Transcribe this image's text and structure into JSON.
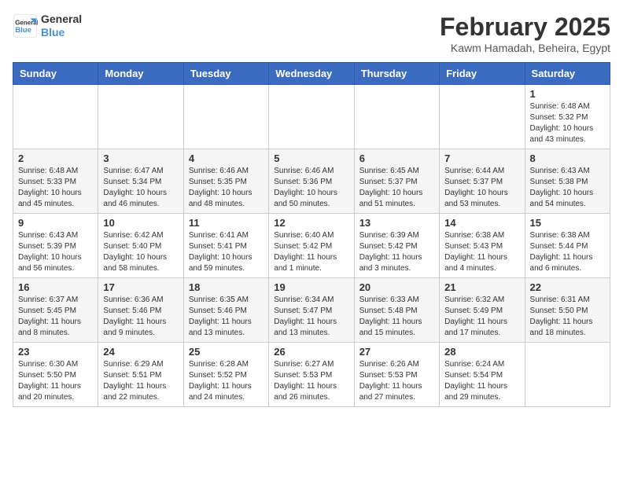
{
  "header": {
    "logo_line1": "General",
    "logo_line2": "Blue",
    "title": "February 2025",
    "subtitle": "Kawm Hamadah, Beheira, Egypt"
  },
  "calendar": {
    "headers": [
      "Sunday",
      "Monday",
      "Tuesday",
      "Wednesday",
      "Thursday",
      "Friday",
      "Saturday"
    ],
    "weeks": [
      [
        {
          "day": "",
          "info": ""
        },
        {
          "day": "",
          "info": ""
        },
        {
          "day": "",
          "info": ""
        },
        {
          "day": "",
          "info": ""
        },
        {
          "day": "",
          "info": ""
        },
        {
          "day": "",
          "info": ""
        },
        {
          "day": "1",
          "info": "Sunrise: 6:48 AM\nSunset: 5:32 PM\nDaylight: 10 hours and 43 minutes."
        }
      ],
      [
        {
          "day": "2",
          "info": "Sunrise: 6:48 AM\nSunset: 5:33 PM\nDaylight: 10 hours and 45 minutes."
        },
        {
          "day": "3",
          "info": "Sunrise: 6:47 AM\nSunset: 5:34 PM\nDaylight: 10 hours and 46 minutes."
        },
        {
          "day": "4",
          "info": "Sunrise: 6:46 AM\nSunset: 5:35 PM\nDaylight: 10 hours and 48 minutes."
        },
        {
          "day": "5",
          "info": "Sunrise: 6:46 AM\nSunset: 5:36 PM\nDaylight: 10 hours and 50 minutes."
        },
        {
          "day": "6",
          "info": "Sunrise: 6:45 AM\nSunset: 5:37 PM\nDaylight: 10 hours and 51 minutes."
        },
        {
          "day": "7",
          "info": "Sunrise: 6:44 AM\nSunset: 5:37 PM\nDaylight: 10 hours and 53 minutes."
        },
        {
          "day": "8",
          "info": "Sunrise: 6:43 AM\nSunset: 5:38 PM\nDaylight: 10 hours and 54 minutes."
        }
      ],
      [
        {
          "day": "9",
          "info": "Sunrise: 6:43 AM\nSunset: 5:39 PM\nDaylight: 10 hours and 56 minutes."
        },
        {
          "day": "10",
          "info": "Sunrise: 6:42 AM\nSunset: 5:40 PM\nDaylight: 10 hours and 58 minutes."
        },
        {
          "day": "11",
          "info": "Sunrise: 6:41 AM\nSunset: 5:41 PM\nDaylight: 10 hours and 59 minutes."
        },
        {
          "day": "12",
          "info": "Sunrise: 6:40 AM\nSunset: 5:42 PM\nDaylight: 11 hours and 1 minute."
        },
        {
          "day": "13",
          "info": "Sunrise: 6:39 AM\nSunset: 5:42 PM\nDaylight: 11 hours and 3 minutes."
        },
        {
          "day": "14",
          "info": "Sunrise: 6:38 AM\nSunset: 5:43 PM\nDaylight: 11 hours and 4 minutes."
        },
        {
          "day": "15",
          "info": "Sunrise: 6:38 AM\nSunset: 5:44 PM\nDaylight: 11 hours and 6 minutes."
        }
      ],
      [
        {
          "day": "16",
          "info": "Sunrise: 6:37 AM\nSunset: 5:45 PM\nDaylight: 11 hours and 8 minutes."
        },
        {
          "day": "17",
          "info": "Sunrise: 6:36 AM\nSunset: 5:46 PM\nDaylight: 11 hours and 9 minutes."
        },
        {
          "day": "18",
          "info": "Sunrise: 6:35 AM\nSunset: 5:46 PM\nDaylight: 11 hours and 13 minutes."
        },
        {
          "day": "19",
          "info": "Sunrise: 6:34 AM\nSunset: 5:47 PM\nDaylight: 11 hours and 13 minutes."
        },
        {
          "day": "20",
          "info": "Sunrise: 6:33 AM\nSunset: 5:48 PM\nDaylight: 11 hours and 15 minutes."
        },
        {
          "day": "21",
          "info": "Sunrise: 6:32 AM\nSunset: 5:49 PM\nDaylight: 11 hours and 17 minutes."
        },
        {
          "day": "22",
          "info": "Sunrise: 6:31 AM\nSunset: 5:50 PM\nDaylight: 11 hours and 18 minutes."
        }
      ],
      [
        {
          "day": "23",
          "info": "Sunrise: 6:30 AM\nSunset: 5:50 PM\nDaylight: 11 hours and 20 minutes."
        },
        {
          "day": "24",
          "info": "Sunrise: 6:29 AM\nSunset: 5:51 PM\nDaylight: 11 hours and 22 minutes."
        },
        {
          "day": "25",
          "info": "Sunrise: 6:28 AM\nSunset: 5:52 PM\nDaylight: 11 hours and 24 minutes."
        },
        {
          "day": "26",
          "info": "Sunrise: 6:27 AM\nSunset: 5:53 PM\nDaylight: 11 hours and 26 minutes."
        },
        {
          "day": "27",
          "info": "Sunrise: 6:26 AM\nSunset: 5:53 PM\nDaylight: 11 hours and 27 minutes."
        },
        {
          "day": "28",
          "info": "Sunrise: 6:24 AM\nSunset: 5:54 PM\nDaylight: 11 hours and 29 minutes."
        },
        {
          "day": "",
          "info": ""
        }
      ]
    ]
  }
}
